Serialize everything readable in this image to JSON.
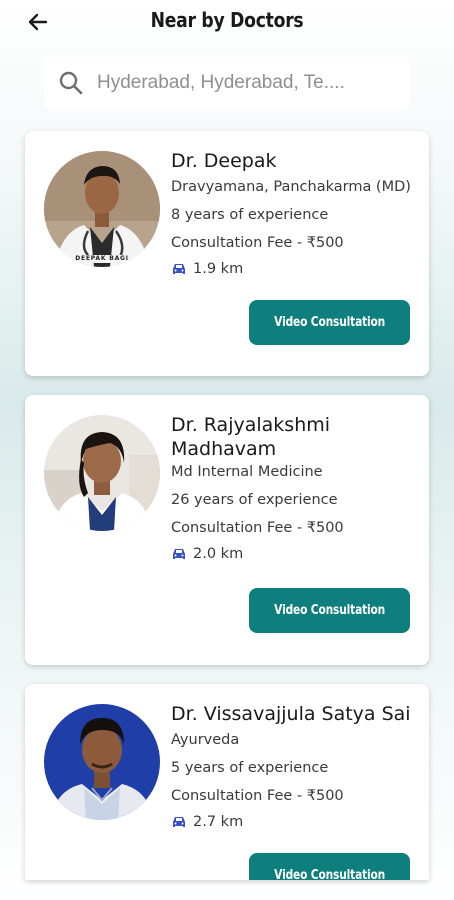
{
  "header": {
    "title": "Near by Doctors"
  },
  "search": {
    "placeholder": "Hyderabad, Hyderabad, Te...."
  },
  "doctors": [
    {
      "name": "Dr. Deepak",
      "specialty": "Dravyamana, Panchakarma (MD)",
      "experience": "8 years of experience",
      "fee": "Consultation Fee - ₹500",
      "distance": "1.9 km",
      "button": "Video Consultation",
      "photo_caption": "DEEPAK BAGI"
    },
    {
      "name": "Dr. Rajyalakshmi Madhavam",
      "specialty": "Md Internal Medicine",
      "experience": "26 years of experience",
      "fee": "Consultation Fee - ₹500",
      "distance": "2.0 km",
      "button": "Video Consultation"
    },
    {
      "name": "Dr. Vissavajjula Satya Sai",
      "specialty": "Ayurveda",
      "experience": "5 years of experience",
      "fee": "Consultation Fee - ₹500",
      "distance": "2.7 km",
      "button": "Video Consultation"
    }
  ],
  "colors": {
    "accent": "#0e7f7d",
    "car_icon": "#3b4fc4"
  }
}
